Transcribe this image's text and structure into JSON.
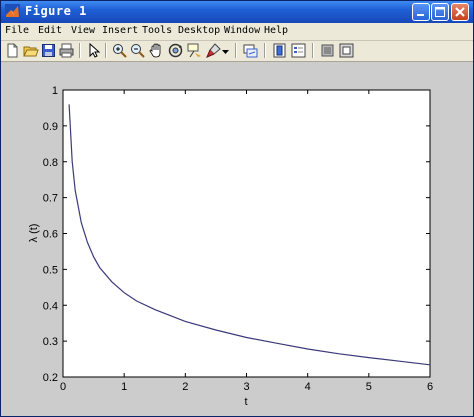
{
  "window": {
    "title": "Figure 1"
  },
  "menu": [
    "File",
    "Edit",
    "View",
    "Insert",
    "Tools",
    "Desktop",
    "Window",
    "Help"
  ],
  "toolbar": {
    "icons": [
      "new-figure-icon",
      "open-file-icon",
      "save-icon",
      "print-icon",
      "pointer-icon",
      "zoom-in-icon",
      "zoom-out-icon",
      "pan-icon",
      "rotate-3d-icon",
      "data-cursor-icon",
      "brush-icon",
      "brush-dropdown-icon",
      "link-plot-icon",
      "colorbar-icon",
      "legend-icon",
      "hide-plot-tools-icon",
      "show-plot-tools-icon"
    ]
  },
  "colors": {
    "line": "#3a3a7a",
    "titlebar": "#1f5fd6",
    "figure_bg": "#cccccc"
  },
  "chart_data": {
    "type": "line",
    "title": "",
    "xlabel": "t",
    "ylabel": "λ (t)",
    "xlim": [
      0,
      6
    ],
    "ylim": [
      0.2,
      1
    ],
    "xticks": [
      "0",
      "1",
      "2",
      "3",
      "4",
      "5",
      "6"
    ],
    "yticks": [
      "0.2",
      "0.3",
      "0.4",
      "0.5",
      "0.6",
      "0.7",
      "0.8",
      "0.9",
      "1"
    ],
    "grid": false,
    "series": [
      {
        "x": [
          0.1,
          0.15,
          0.2,
          0.3,
          0.4,
          0.5,
          0.6,
          0.8,
          1.0,
          1.2,
          1.5,
          2.0,
          2.5,
          3.0,
          3.5,
          4.0,
          4.5,
          5.0,
          5.5,
          6.0
        ],
        "y": [
          0.96,
          0.8,
          0.72,
          0.63,
          0.575,
          0.535,
          0.505,
          0.465,
          0.435,
          0.412,
          0.388,
          0.355,
          0.331,
          0.31,
          0.294,
          0.278,
          0.265,
          0.254,
          0.244,
          0.234
        ]
      }
    ]
  }
}
